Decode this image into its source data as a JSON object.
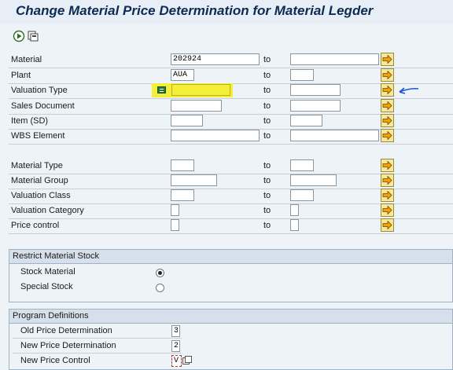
{
  "title": "Change Material Price Determination for Material Legder",
  "toolbar": {
    "execute_icon": "execute-icon",
    "save_variant_icon": "save-variant-icon"
  },
  "to_label": "to",
  "criteria": [
    {
      "label": "Material",
      "from": "202924"
    },
    {
      "label": "Plant",
      "from": "AUA"
    },
    {
      "label": "Valuation Type",
      "from": ""
    },
    {
      "label": "Sales Document",
      "from": ""
    },
    {
      "label": "Item (SD)",
      "from": ""
    },
    {
      "label": "WBS Element",
      "from": ""
    },
    {
      "label": "Material Type",
      "from": ""
    },
    {
      "label": "Material Group",
      "from": ""
    },
    {
      "label": "Valuation Class",
      "from": ""
    },
    {
      "label": "Valuation Category",
      "from": ""
    },
    {
      "label": "Price control",
      "from": ""
    }
  ],
  "restrict": {
    "header": "Restrict Material Stock",
    "stock_material": "Stock Material",
    "special_stock": "Special Stock",
    "selected": "Stock Material"
  },
  "program": {
    "header": "Program Definitions",
    "old_label": "Old Price Determination",
    "old_value": "3",
    "new_label": "New Price Determination",
    "new_value": "2",
    "control_label": "New Price Control",
    "control_value": "V"
  },
  "colors": {
    "highlight": "#f3ee3a",
    "title": "#0b2b52",
    "arrow": "#1a55d6"
  }
}
